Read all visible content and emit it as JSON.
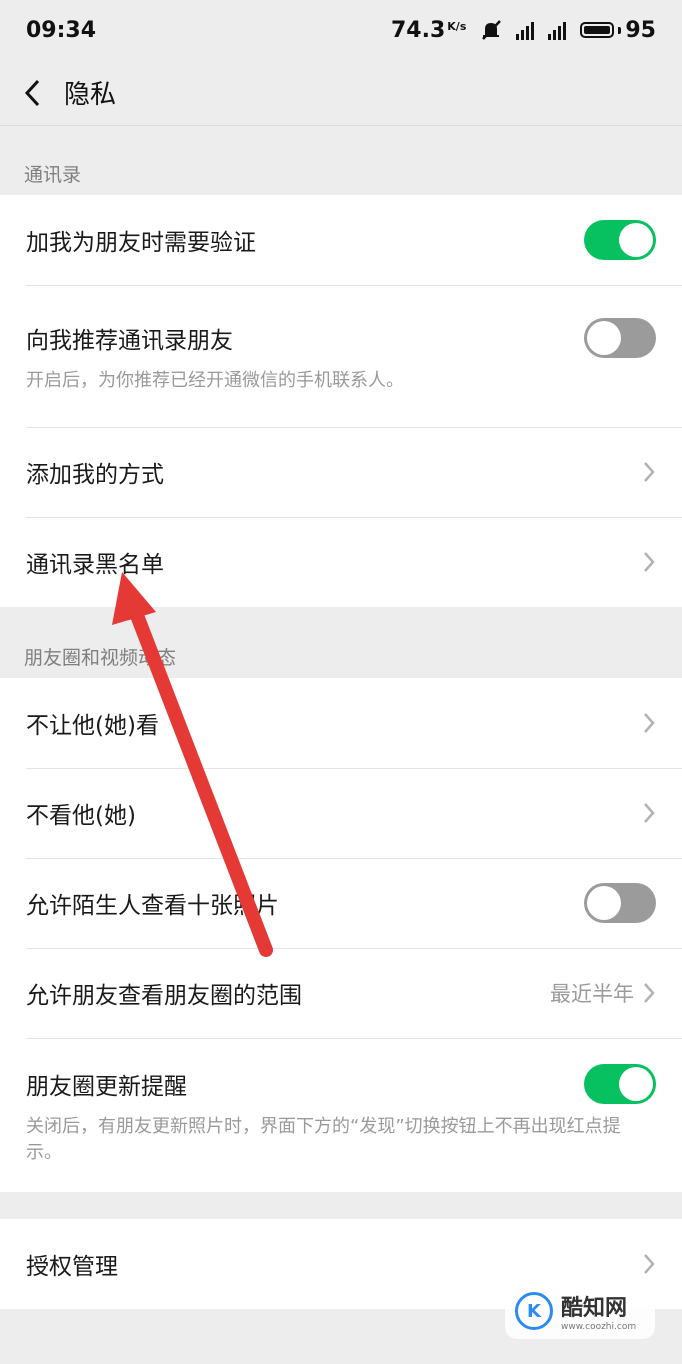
{
  "status": {
    "time": "09:34",
    "speed": "74.3",
    "speed_unit": "K/s",
    "battery": "95"
  },
  "nav": {
    "title": "隐私"
  },
  "sections": {
    "contacts": {
      "title": "通讯录"
    },
    "moments": {
      "title": "朋友圈和视频动态"
    }
  },
  "rows": {
    "verify": {
      "label": "加我为朋友时需要验证",
      "toggle": "on"
    },
    "recommend": {
      "label": "向我推荐通讯录朋友",
      "desc": "开启后，为你推荐已经开通微信的手机联系人。",
      "toggle": "off"
    },
    "add_methods": {
      "label": "添加我的方式"
    },
    "blacklist": {
      "label": "通讯录黑名单"
    },
    "hide_from": {
      "label": "不让他(她)看"
    },
    "dont_see": {
      "label": "不看他(她)"
    },
    "stranger_photos": {
      "label": "允许陌生人查看十张照片",
      "toggle": "off"
    },
    "range": {
      "label": "允许朋友查看朋友圈的范围",
      "value": "最近半年"
    },
    "moments_notify": {
      "label": "朋友圈更新提醒",
      "desc": "关闭后，有朋友更新照片时，界面下方的“发现”切换按钮上不再出现红点提示。",
      "toggle": "on"
    },
    "auth": {
      "label": "授权管理"
    }
  },
  "watermark": {
    "name": "酷知网",
    "url": "www.coozhi.com"
  },
  "colors": {
    "toggle_on": "#07c160",
    "toggle_off": "#9b9b9b",
    "annotation_arrow": "#e53935"
  }
}
